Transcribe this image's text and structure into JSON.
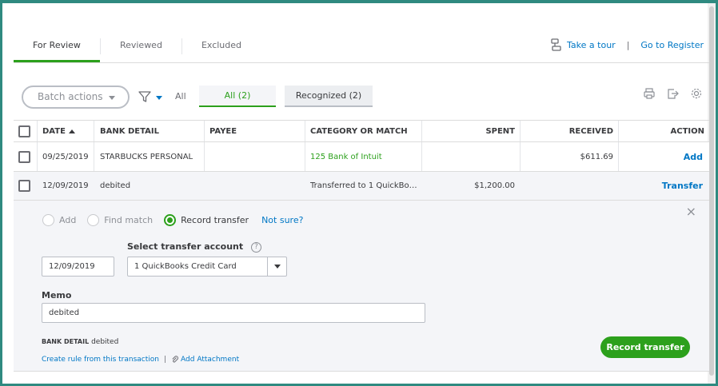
{
  "tabs": [
    {
      "label": "For Review"
    },
    {
      "label": "Reviewed"
    },
    {
      "label": "Excluded"
    }
  ],
  "top_links": {
    "tour": "Take a tour",
    "separator": "|",
    "register": "Go to Register"
  },
  "filter_bar": {
    "batch_actions": "Batch actions",
    "all_text": "All",
    "pill_all": "All (2)",
    "pill_recognized": "Recognized (2)"
  },
  "table": {
    "headers": {
      "date": "DATE",
      "bank_detail": "BANK DETAIL",
      "payee": "PAYEE",
      "category": "CATEGORY OR MATCH",
      "spent": "SPENT",
      "received": "RECEIVED",
      "action": "ACTION"
    },
    "rows": [
      {
        "date": "09/25/2019",
        "bank_detail": "STARBUCKS PERSONAL",
        "payee": "",
        "category": "125 Bank of Intuit",
        "spent": "",
        "received": "$611.69",
        "action": "Add"
      },
      {
        "date": "12/09/2019",
        "bank_detail": "debited",
        "payee": "",
        "category": "Transferred to 1 QuickBo…",
        "spent": "$1,200.00",
        "received": "",
        "action": "Transfer"
      }
    ]
  },
  "panel": {
    "radio_options": [
      {
        "label": "Add",
        "selected": false
      },
      {
        "label": "Find match",
        "selected": false
      },
      {
        "label": "Record transfer",
        "selected": true
      }
    ],
    "not_sure": "Not sure?",
    "close": "×",
    "transfer_account_label": "Select transfer account",
    "help": "?",
    "date_value": "12/09/2019",
    "account_value": "1 QuickBooks Credit Card",
    "memo_label": "Memo",
    "memo_value": "debited",
    "bank_detail_label": "BANK DETAIL",
    "bank_detail_value": "debited",
    "create_rule": "Create rule from this transaction",
    "link_separator": "|",
    "add_attachment": "Add Attachment",
    "record_button": "Record transfer"
  },
  "colors": {
    "accent_green": "#2ca01c",
    "link_blue": "#0077c5",
    "frame_teal": "#2f8a80"
  }
}
